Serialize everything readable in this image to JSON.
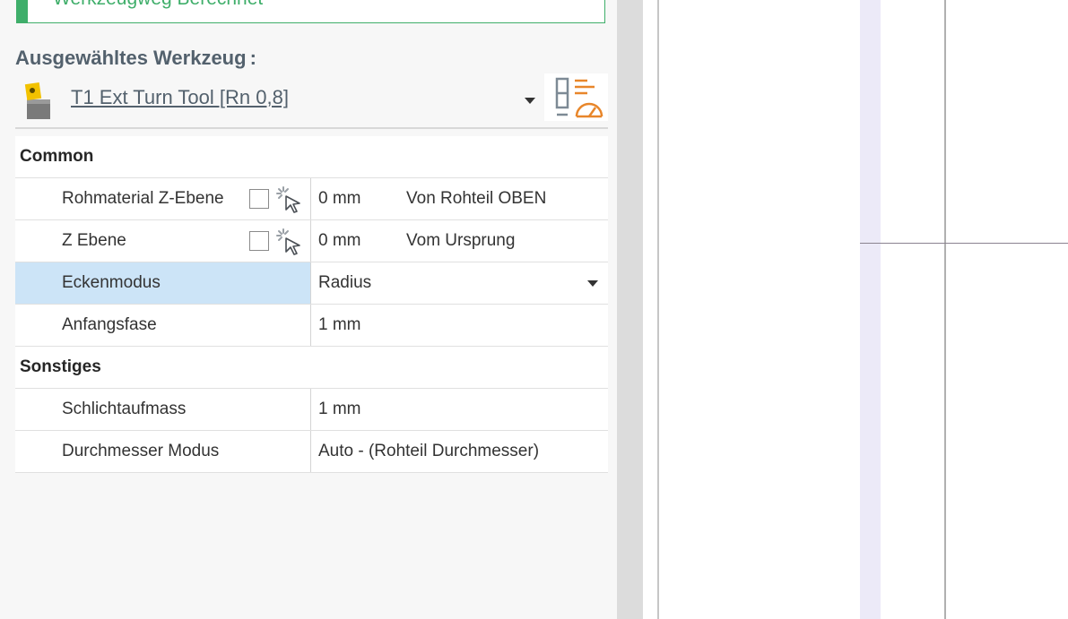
{
  "status": {
    "text": "Werkzeugweg Berechnet",
    "color": "#3fae6a"
  },
  "tool_section": {
    "label": "Ausgewähltes Werkzeug",
    "colon": ":",
    "tool_name": "T1 Ext Turn Tool  [Rn 0,8]",
    "icons": [
      "turn-tool-icon",
      "dropdown-arrow-icon",
      "tool-parameters-icon"
    ]
  },
  "groups": {
    "common": "Common",
    "other": "Sonstiges"
  },
  "properties": {
    "stock_z": {
      "name": "Rohmaterial Z-Ebene",
      "value": "0 mm",
      "ref": "Von Rohteil OBEN"
    },
    "z_plane": {
      "name": "Z Ebene",
      "value": "0 mm",
      "ref": "Vom Ursprung"
    },
    "corner_mode": {
      "name": "Eckenmodus",
      "value": "Radius"
    },
    "start_chamfer": {
      "name": "Anfangsfase",
      "value": "1 mm"
    },
    "finish_allowance": {
      "name": "Schlichtaufmass",
      "value": "1 mm"
    },
    "diameter_mode": {
      "name": "Durchmesser Modus",
      "value": "Auto - (Rohteil Durchmesser)"
    }
  },
  "colors": {
    "accent_green": "#3fae6a",
    "selection": "#cce4f7",
    "icon_orange": "#e8862a",
    "heading_grey": "#53616d"
  }
}
